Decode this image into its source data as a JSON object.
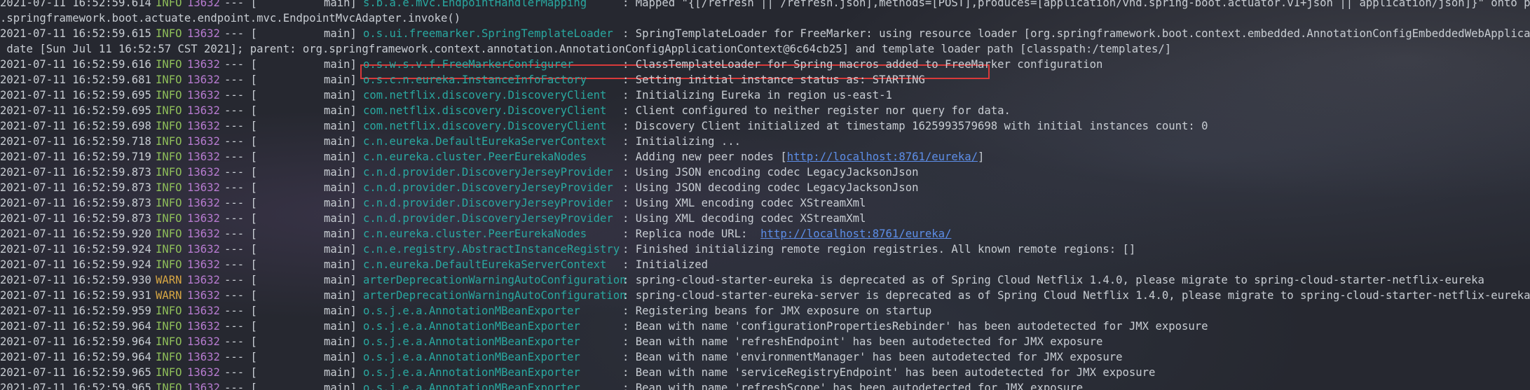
{
  "lines": [
    {
      "ts": "2021-07-11 16:52:59.614",
      "lv": "INFO",
      "pid": "13632",
      "sep": "--- [",
      "thr": "main]",
      "lg": "s.b.a.e.mvc.EndpointHandlerMapping",
      "msg": ": Mapped \"{[/refresh || /refresh.json],methods=[POST],produces=[application/vnd.spring-boot.actuator.v1+json || application/json]}\" onto public java.lang.Object"
    },
    {
      "ts": "",
      "lv": "",
      "pid": "",
      "sep": "",
      "thr": "",
      "lg": "",
      "msg": ".springframework.boot.actuate.endpoint.mvc.EndpointMvcAdapter.invoke()"
    },
    {
      "ts": "2021-07-11 16:52:59.615",
      "lv": "INFO",
      "pid": "13632",
      "sep": "--- [",
      "thr": "main]",
      "lg": "o.s.ui.freemarker.SpringTemplateLoader",
      "msg": ": SpringTemplateLoader for FreeMarker: using resource loader [org.springframework.boot.context.embedded.AnnotationConfigEmbeddedWebApplicationCon"
    },
    {
      "ts": "",
      "lv": "",
      "pid": "",
      "sep": "",
      "thr": "",
      "lg": "",
      "msg": " date [Sun Jul 11 16:52:57 CST 2021]; parent: org.springframework.context.annotation.AnnotationConfigApplicationContext@6c64cb25] and template loader path [classpath:/templates/]"
    },
    {
      "ts": "2021-07-11 16:52:59.616",
      "lv": "INFO",
      "pid": "13632",
      "sep": "--- [",
      "thr": "main]",
      "lg": "o.s.w.s.v.f.FreeMarkerConfigurer",
      "msg": ": ClassTemplateLoader for Spring macros added to FreeMarker configuration"
    },
    {
      "ts": "2021-07-11 16:52:59.681",
      "lv": "INFO",
      "pid": "13632",
      "sep": "--- [",
      "thr": "main]",
      "lg": "o.s.c.n.eureka.InstanceInfoFactory",
      "msg": ": Setting initial instance status as: STARTING"
    },
    {
      "ts": "2021-07-11 16:52:59.695",
      "lv": "INFO",
      "pid": "13632",
      "sep": "--- [",
      "thr": "main]",
      "lg": "com.netflix.discovery.DiscoveryClient",
      "msg": ": Initializing Eureka in region us-east-1"
    },
    {
      "ts": "2021-07-11 16:52:59.695",
      "lv": "INFO",
      "pid": "13632",
      "sep": "--- [",
      "thr": "main]",
      "lg": "com.netflix.discovery.DiscoveryClient",
      "msg": ": Client configured to neither register nor query for data."
    },
    {
      "ts": "2021-07-11 16:52:59.698",
      "lv": "INFO",
      "pid": "13632",
      "sep": "--- [",
      "thr": "main]",
      "lg": "com.netflix.discovery.DiscoveryClient",
      "msg": ": Discovery Client initialized at timestamp 1625993579698 with initial instances count: 0"
    },
    {
      "ts": "2021-07-11 16:52:59.718",
      "lv": "INFO",
      "pid": "13632",
      "sep": "--- [",
      "thr": "main]",
      "lg": "c.n.eureka.DefaultEurekaServerContext",
      "msg": ": Initializing ..."
    },
    {
      "ts": "2021-07-11 16:52:59.719",
      "lv": "INFO",
      "pid": "13632",
      "sep": "--- [",
      "thr": "main]",
      "lg": "c.n.eureka.cluster.PeerEurekaNodes",
      "msg": ": Adding new peer nodes [",
      "link": "http://localhost:8761/eureka/",
      "after": "]"
    },
    {
      "ts": "2021-07-11 16:52:59.873",
      "lv": "INFO",
      "pid": "13632",
      "sep": "--- [",
      "thr": "main]",
      "lg": "c.n.d.provider.DiscoveryJerseyProvider",
      "msg": ": Using JSON encoding codec LegacyJacksonJson"
    },
    {
      "ts": "2021-07-11 16:52:59.873",
      "lv": "INFO",
      "pid": "13632",
      "sep": "--- [",
      "thr": "main]",
      "lg": "c.n.d.provider.DiscoveryJerseyProvider",
      "msg": ": Using JSON decoding codec LegacyJacksonJson"
    },
    {
      "ts": "2021-07-11 16:52:59.873",
      "lv": "INFO",
      "pid": "13632",
      "sep": "--- [",
      "thr": "main]",
      "lg": "c.n.d.provider.DiscoveryJerseyProvider",
      "msg": ": Using XML encoding codec XStreamXml"
    },
    {
      "ts": "2021-07-11 16:52:59.873",
      "lv": "INFO",
      "pid": "13632",
      "sep": "--- [",
      "thr": "main]",
      "lg": "c.n.d.provider.DiscoveryJerseyProvider",
      "msg": ": Using XML decoding codec XStreamXml"
    },
    {
      "ts": "2021-07-11 16:52:59.920",
      "lv": "INFO",
      "pid": "13632",
      "sep": "--- [",
      "thr": "main]",
      "lg": "c.n.eureka.cluster.PeerEurekaNodes",
      "msg": ": Replica node URL:  ",
      "link": "http://localhost:8761/eureka/",
      "after": ""
    },
    {
      "ts": "2021-07-11 16:52:59.924",
      "lv": "INFO",
      "pid": "13632",
      "sep": "--- [",
      "thr": "main]",
      "lg": "c.n.e.registry.AbstractInstanceRegistry",
      "msg": ": Finished initializing remote region registries. All known remote regions: []"
    },
    {
      "ts": "2021-07-11 16:52:59.924",
      "lv": "INFO",
      "pid": "13632",
      "sep": "--- [",
      "thr": "main]",
      "lg": "c.n.eureka.DefaultEurekaServerContext",
      "msg": ": Initialized"
    },
    {
      "ts": "2021-07-11 16:52:59.930",
      "lv": "WARN",
      "pid": "13632",
      "sep": "--- [",
      "thr": "main]",
      "lg": "arterDeprecationWarningAutoConfiguration",
      "msg": ": spring-cloud-starter-eureka is deprecated as of Spring Cloud Netflix 1.4.0, please migrate to spring-cloud-starter-netflix-eureka"
    },
    {
      "ts": "2021-07-11 16:52:59.931",
      "lv": "WARN",
      "pid": "13632",
      "sep": "--- [",
      "thr": "main]",
      "lg": "arterDeprecationWarningAutoConfiguration",
      "msg": ": spring-cloud-starter-eureka-server is deprecated as of Spring Cloud Netflix 1.4.0, please migrate to spring-cloud-starter-netflix-eureka-server"
    },
    {
      "ts": "2021-07-11 16:52:59.959",
      "lv": "INFO",
      "pid": "13632",
      "sep": "--- [",
      "thr": "main]",
      "lg": "o.s.j.e.a.AnnotationMBeanExporter",
      "msg": ": Registering beans for JMX exposure on startup"
    },
    {
      "ts": "2021-07-11 16:52:59.964",
      "lv": "INFO",
      "pid": "13632",
      "sep": "--- [",
      "thr": "main]",
      "lg": "o.s.j.e.a.AnnotationMBeanExporter",
      "msg": ": Bean with name 'configurationPropertiesRebinder' has been autodetected for JMX exposure"
    },
    {
      "ts": "2021-07-11 16:52:59.964",
      "lv": "INFO",
      "pid": "13632",
      "sep": "--- [",
      "thr": "main]",
      "lg": "o.s.j.e.a.AnnotationMBeanExporter",
      "msg": ": Bean with name 'refreshEndpoint' has been autodetected for JMX exposure"
    },
    {
      "ts": "2021-07-11 16:52:59.964",
      "lv": "INFO",
      "pid": "13632",
      "sep": "--- [",
      "thr": "main]",
      "lg": "o.s.j.e.a.AnnotationMBeanExporter",
      "msg": ": Bean with name 'environmentManager' has been autodetected for JMX exposure"
    },
    {
      "ts": "2021-07-11 16:52:59.965",
      "lv": "INFO",
      "pid": "13632",
      "sep": "--- [",
      "thr": "main]",
      "lg": "o.s.j.e.a.AnnotationMBeanExporter",
      "msg": ": Bean with name 'serviceRegistryEndpoint' has been autodetected for JMX exposure"
    },
    {
      "ts": "2021-07-11 16:52:59.965",
      "lv": "INFO",
      "pid": "13632",
      "sep": "--- [",
      "thr": "main]",
      "lg": "o.s.j.e.a.AnnotationMBeanExporter",
      "msg": ": Bean with name 'refreshScope' has been autodetected for JMX exposure"
    }
  ],
  "colors": {
    "info": "#8fbf5a",
    "warn": "#d7a643",
    "pid": "#b77bd0",
    "logger": "#29a8a0",
    "link": "#5d8ee8",
    "highlight": "#d83a3a"
  }
}
